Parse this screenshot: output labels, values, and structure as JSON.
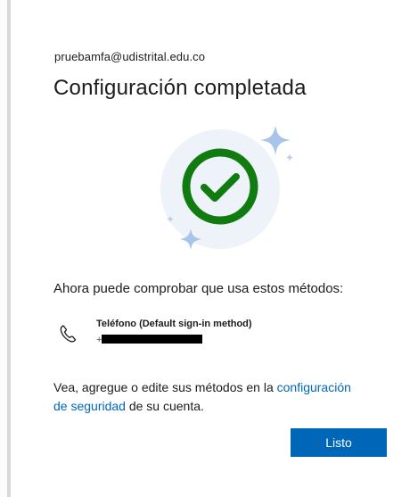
{
  "account": {
    "email": "pruebamfa@udistrital.edu.co"
  },
  "header": {
    "title": "Configuración completada"
  },
  "illustration": {
    "icon": "success-checkmark-icon",
    "colors": {
      "ring": "#107c10",
      "halo": "#eef3fa",
      "sparkle": "#a9c4ea"
    }
  },
  "main": {
    "subtitle": "Ahora puede comprobar que usa estos métodos:",
    "methods": [
      {
        "icon": "phone-icon",
        "label": "Teléfono (Default sign-in method)",
        "value_prefix": "+"
      }
    ],
    "info_before_link": "Vea, agregue o edite sus métodos en la ",
    "info_link": "configuración de seguridad",
    "info_after_link": " de su cuenta."
  },
  "actions": {
    "done_label": "Listo"
  },
  "colors": {
    "accent": "#0067b8",
    "text": "#1b1b1b"
  }
}
